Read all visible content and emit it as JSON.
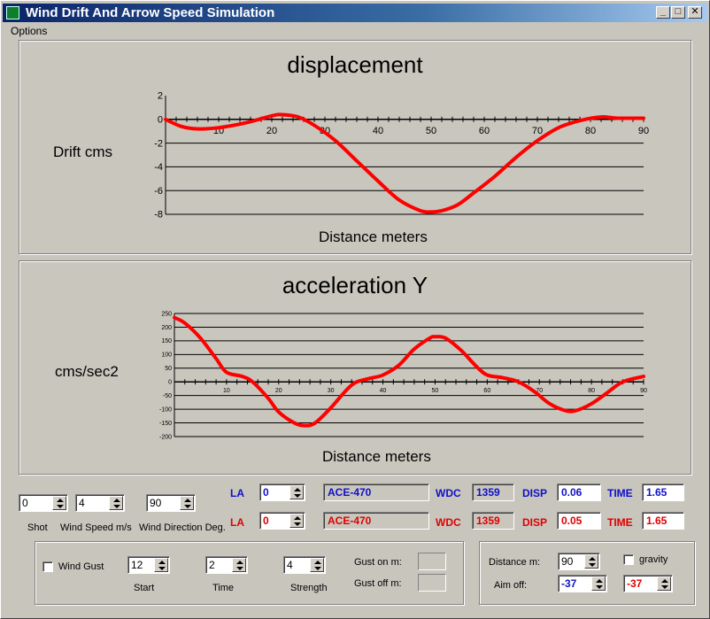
{
  "window": {
    "title": "Wind Drift And Arrow Speed Simulation",
    "minimize": "_",
    "maximize": "□",
    "close": "✕"
  },
  "menu": {
    "options": "Options"
  },
  "chart_data": [
    {
      "type": "line",
      "title": "displacement",
      "xlabel": "Distance meters",
      "ylabel": "Drift cms",
      "xlim": [
        0,
        90
      ],
      "ylim": [
        -8,
        2
      ],
      "x_ticks": [
        "10",
        "20",
        "30",
        "40",
        "50",
        "60",
        "70",
        "80",
        "90"
      ],
      "y_ticks": [
        "2",
        "0",
        "-2",
        "-4",
        "-6",
        "-8"
      ],
      "series": [
        {
          "color": "#ff0000",
          "x": [
            0,
            3,
            6,
            10,
            15,
            20,
            22,
            25,
            28,
            32,
            36,
            40,
            44,
            48,
            50,
            52,
            55,
            58,
            62,
            66,
            70,
            74,
            78,
            82,
            85,
            90
          ],
          "y": [
            0,
            -0.6,
            -0.8,
            -0.7,
            -0.3,
            0.3,
            0.4,
            0.2,
            -0.5,
            -1.8,
            -3.5,
            -5.2,
            -6.8,
            -7.7,
            -7.8,
            -7.7,
            -7.2,
            -6.2,
            -4.8,
            -3.2,
            -1.8,
            -0.7,
            -0.1,
            0.2,
            0.1,
            0.1
          ]
        }
      ]
    },
    {
      "type": "line",
      "title": "acceleration Y",
      "xlabel": "Distance meters",
      "ylabel": "cms/sec2",
      "xlim": [
        0,
        90
      ],
      "ylim": [
        -200,
        250
      ],
      "x_ticks": [
        "10",
        "20",
        "30",
        "40",
        "50",
        "60",
        "70",
        "80",
        "90"
      ],
      "y_ticks": [
        "250",
        "200",
        "150",
        "100",
        "50",
        "0",
        "-50",
        "-100",
        "-150",
        "-200"
      ],
      "series": [
        {
          "color": "#ff0000",
          "x": [
            0,
            2,
            5,
            8,
            10,
            13,
            15,
            18,
            20,
            23,
            25,
            27,
            30,
            33,
            35,
            38,
            40,
            43,
            46,
            49,
            50,
            52,
            55,
            58,
            60,
            63,
            66,
            69,
            72,
            75,
            77,
            80,
            83,
            86,
            90
          ],
          "y": [
            235,
            215,
            160,
            85,
            35,
            20,
            0,
            -60,
            -110,
            -150,
            -160,
            -150,
            -95,
            -30,
            0,
            15,
            25,
            60,
            120,
            160,
            165,
            160,
            115,
            55,
            25,
            15,
            0,
            -35,
            -80,
            -105,
            -105,
            -80,
            -40,
            0,
            20
          ]
        }
      ]
    }
  ],
  "controls": {
    "shot": {
      "value": "0",
      "label": "Shot"
    },
    "wind_speed": {
      "value": "4",
      "label": "Wind Speed m/s"
    },
    "wind_direction": {
      "value": "90",
      "label": "Wind Direction Deg."
    },
    "row1": {
      "la_label": "LA",
      "la_value": "0",
      "arrow": "ACE-470",
      "wdc_label": "WDC",
      "wdc": "1359",
      "disp_label": "DISP",
      "disp": "0.06",
      "time_label": "TIME",
      "time": "1.65"
    },
    "row2": {
      "la_label": "LA",
      "la_value": "0",
      "arrow": "ACE-470",
      "wdc_label": "WDC",
      "wdc": "1359",
      "disp_label": "DISP",
      "disp": "0.05",
      "time_label": "TIME",
      "time": "1.65"
    },
    "gust": {
      "checkbox_label": "Wind Gust",
      "start": {
        "value": "12",
        "label": "Start"
      },
      "time": {
        "value": "2",
        "label": "Time"
      },
      "strength": {
        "value": "4",
        "label": "Strength"
      },
      "gust_on_label": "Gust on m:",
      "gust_off_label": "Gust off m:"
    },
    "aim": {
      "distance_label": "Distance m:",
      "distance": "90",
      "gravity_label": "gravity",
      "aim_off_label": "Aim off:",
      "aim_blue": "-37",
      "aim_red": "-37"
    }
  }
}
